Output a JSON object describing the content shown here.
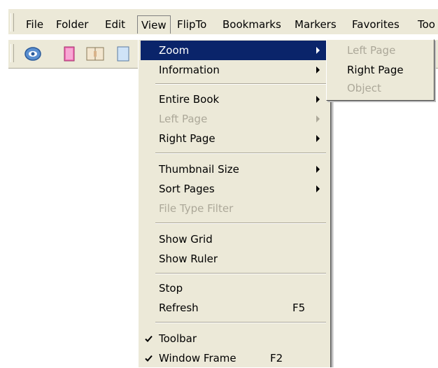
{
  "menubar": {
    "items": [
      {
        "label": "File"
      },
      {
        "label": "Folder"
      },
      {
        "label": "Edit"
      },
      {
        "label": "View"
      },
      {
        "label": "FlipTo"
      },
      {
        "label": "Bookmarks"
      },
      {
        "label": "Markers"
      },
      {
        "label": "Favorites"
      },
      {
        "label": "Too"
      }
    ]
  },
  "toolbar": {
    "buttons": [
      {
        "icon": "eye-icon"
      },
      {
        "icon": "pink-page-icon"
      },
      {
        "icon": "book-icon"
      },
      {
        "icon": "page-icon"
      }
    ]
  },
  "view_menu": {
    "items": [
      {
        "label": "Zoom",
        "has_submenu": true,
        "highlighted": true
      },
      {
        "label": "Information",
        "has_submenu": true
      },
      {
        "label": "Entire Book",
        "has_submenu": true
      },
      {
        "label": "Left Page",
        "has_submenu": true,
        "disabled": true
      },
      {
        "label": "Right Page",
        "has_submenu": true
      },
      {
        "label": "Thumbnail Size",
        "has_submenu": true
      },
      {
        "label": "Sort Pages",
        "has_submenu": true
      },
      {
        "label": "File Type Filter",
        "disabled": true
      },
      {
        "label": "Show Grid"
      },
      {
        "label": "Show Ruler"
      },
      {
        "label": "Stop"
      },
      {
        "label": "Refresh",
        "shortcut": "F5"
      },
      {
        "label": "Toolbar",
        "checked": true
      },
      {
        "label": "Window Frame",
        "shortcut": "F2",
        "checked": true
      }
    ]
  },
  "zoom_submenu": {
    "items": [
      {
        "label": "Left Page",
        "disabled": true
      },
      {
        "label": "Right Page"
      },
      {
        "label": "Object",
        "disabled": true
      }
    ]
  },
  "colors": {
    "menu_background": "#ece9d8",
    "highlight": "#0a246a",
    "disabled_text": "#aca899"
  }
}
